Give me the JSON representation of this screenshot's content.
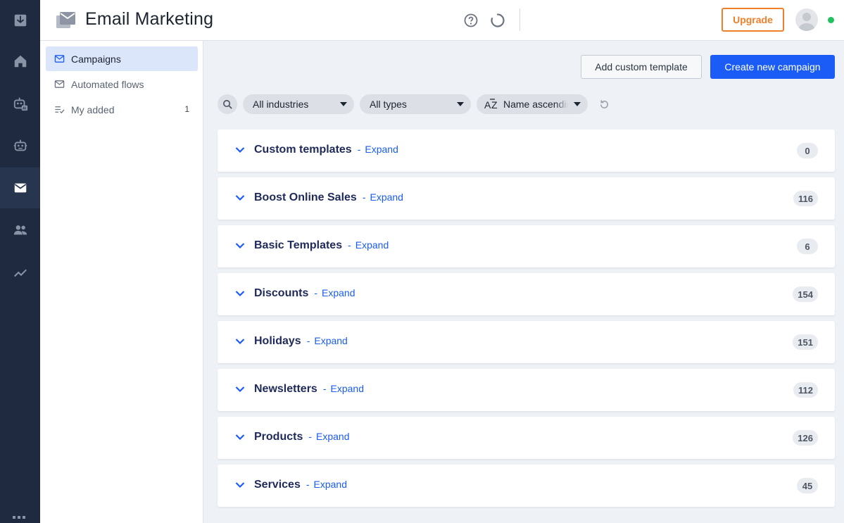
{
  "header": {
    "title": "Email Marketing",
    "upgrade_label": "Upgrade"
  },
  "rail": {
    "items": [
      "inbox-icon",
      "home-icon",
      "ai-bot-icon",
      "bot-icon",
      "email-icon",
      "contacts-icon",
      "analytics-icon"
    ]
  },
  "subnav": {
    "items": [
      {
        "label": "Campaigns",
        "icon": "mail-icon",
        "active": true
      },
      {
        "label": "Automated flows",
        "icon": "mail-icon",
        "active": false
      },
      {
        "label": "My added",
        "icon": "list-check-icon",
        "count": "1"
      }
    ]
  },
  "toolbar": {
    "add_template_label": "Add custom template",
    "create_campaign_label": "Create new campaign"
  },
  "filters": {
    "industry": "All industries",
    "type": "All types",
    "sort": "Name ascending"
  },
  "groups": [
    {
      "title": "Custom templates",
      "expand": "Expand",
      "count": "0"
    },
    {
      "title": "Boost Online Sales",
      "expand": "Expand",
      "count": "116"
    },
    {
      "title": "Basic Templates",
      "expand": "Expand",
      "count": "6"
    },
    {
      "title": "Discounts",
      "expand": "Expand",
      "count": "154"
    },
    {
      "title": "Holidays",
      "expand": "Expand",
      "count": "151"
    },
    {
      "title": "Newsletters",
      "expand": "Expand",
      "count": "112"
    },
    {
      "title": "Products",
      "expand": "Expand",
      "count": "126"
    },
    {
      "title": "Services",
      "expand": "Expand",
      "count": "45"
    }
  ],
  "colors": {
    "rail": "#1f2a40",
    "accent": "#1a5cf5",
    "upgrade": "#f07f2a",
    "online": "#21c25e"
  }
}
